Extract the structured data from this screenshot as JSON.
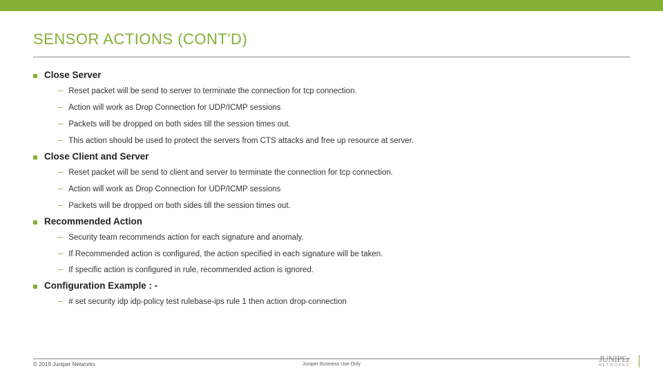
{
  "title": "SENSOR ACTIONS (CONT'D)",
  "sections": [
    {
      "heading": "Close Server",
      "items": [
        "Reset packet will be send to server to terminate the connection for tcp connection.",
        "Action will work as Drop Connection for UDP/ICMP sessions",
        "Packets will be dropped on both sides till the session times out.",
        "This action should be used to protect the servers from CTS attacks and free up resource at server."
      ]
    },
    {
      "heading": "Close Client and Server",
      "items": [
        "Reset packet will be send to client and server to terminate the connection for tcp connection.",
        "Action will work as Drop Connection for UDP/ICMP sessions",
        "Packets will be dropped on both sides till the session times out."
      ]
    },
    {
      "heading": "Recommended Action",
      "items": [
        "Security team recommends action for each signature and anomaly.",
        "If Recommended action is configured, the action specified in each signature will be taken.",
        "If specific action is configured in rule, recommended action is ignored."
      ]
    },
    {
      "heading": "Configuration Example : -",
      "items": [
        "# set security idp idp-policy test rulebase-ips rule 1 then action drop-connection"
      ]
    }
  ],
  "footer": {
    "copyright": "© 2019 Juniper Networks",
    "center": "Juniper Business Use Only",
    "logo_text": "JUNIPEr",
    "logo_sub": "NETWORKS"
  }
}
